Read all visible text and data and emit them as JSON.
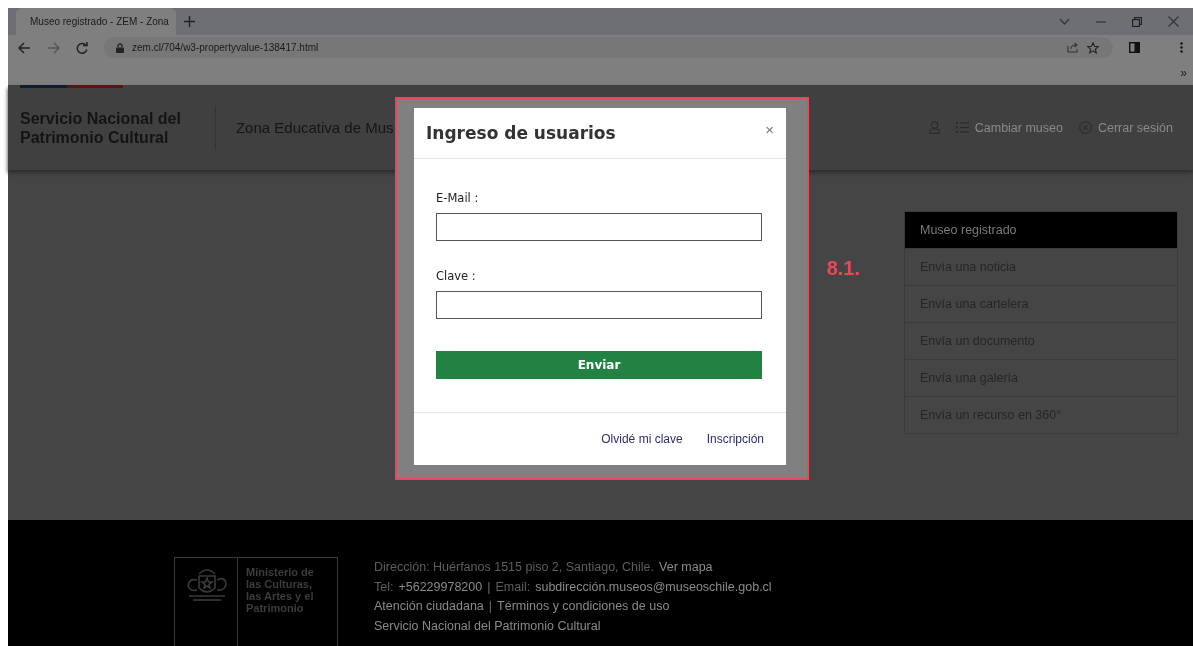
{
  "browser": {
    "tab_title": "Museo registrado - ZEM - Zona",
    "url": "zem.cl/704/w3-propertyvalue-138417.html",
    "bookmarks_overflow": "»"
  },
  "site_header": {
    "org_name": [
      "Servicio Nacional del",
      "Patrimonio Cultural"
    ],
    "section_title": "Zona Educativa de Mus",
    "actions": [
      {
        "kind": "user"
      },
      {
        "kind": "list",
        "label": "Cambiar museo"
      },
      {
        "kind": "logout",
        "label": "Cerrar sesión"
      }
    ]
  },
  "menu": [
    {
      "label": "Museo registrado",
      "selected": true
    },
    {
      "label": "Envía una noticia",
      "selected": false
    },
    {
      "label": "Envía una cartelera",
      "selected": false
    },
    {
      "label": "Envía un documento",
      "selected": false
    },
    {
      "label": "Envía una galería",
      "selected": false
    },
    {
      "label": "Envía un recurso en 360°",
      "selected": false
    }
  ],
  "annotation": "8.1.",
  "modal": {
    "title": "Ingreso de usuarios",
    "close": "×",
    "fields": [
      {
        "label": "E-Mail :"
      },
      {
        "label": "Clave :"
      }
    ],
    "submit": "Enviar",
    "links": [
      "Olvidé mi clave",
      "Inscripción"
    ]
  },
  "footer": {
    "logo_text": [
      "Ministerio de",
      "las Culturas,",
      "las Artes y el",
      "Patrimonio"
    ],
    "lines": [
      [
        {
          "kind": "label",
          "text": "Dirección: Huérfanos 1515 piso 2, Santiago, Chile."
        },
        {
          "kind": "link",
          "text": "Ver mapa"
        }
      ],
      [
        {
          "kind": "label",
          "text": "Tel:"
        },
        {
          "kind": "link",
          "text": "+56229978200"
        },
        {
          "kind": "separator",
          "text": "|"
        },
        {
          "kind": "label",
          "text": "Email:"
        },
        {
          "kind": "link",
          "text": "subdirección.museos@museoschile.gob.cl"
        }
      ],
      [
        {
          "kind": "link",
          "text": "Atención ciudadana"
        },
        {
          "kind": "separator",
          "text": "|"
        },
        {
          "kind": "link",
          "text": "Términos y condiciones de uso"
        }
      ],
      [
        {
          "kind": "text",
          "text": "Servicio Nacional del Patrimonio Cultural"
        }
      ]
    ]
  }
}
